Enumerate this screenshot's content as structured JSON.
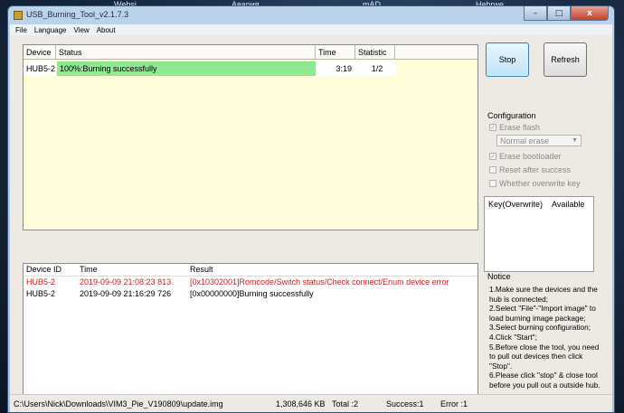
{
  "background_tabs": [
    "Websi",
    "Авария",
    "mAD",
    "Hebrwe"
  ],
  "window": {
    "title": "USB_Burning_Tool_v2.1.7.3",
    "controls": [
      "–",
      "□",
      "x"
    ]
  },
  "menu": [
    "File",
    "Language",
    "View",
    "About"
  ],
  "device_table": {
    "headers": [
      "Device ID",
      "Status",
      "Time",
      "Statistic"
    ],
    "rows": [
      {
        "device": "HUB5-2",
        "status": "100%:Burning successfully",
        "time": "3:19",
        "stat": "1/2",
        "status_color": "#90e890"
      }
    ]
  },
  "buttons": {
    "stop": "Stop",
    "refresh": "Refresh"
  },
  "configuration": {
    "title": "Configuration",
    "erase_flash": "Erase flash",
    "erase_mode": "Normal erase",
    "erase_bootloader": "Erase bootloader",
    "reset_after_success": "Reset after success",
    "overwrite_key": "Whether overwrite key"
  },
  "key_table": {
    "headers": [
      "Key(Overwrite)",
      "Available"
    ]
  },
  "log": {
    "headers": [
      "Device ID",
      "Time",
      "Result"
    ],
    "rows": [
      {
        "device": "HUB5-2",
        "time": "2019-09-09 21:08:23 813",
        "result": "[0x10302001]Romcode/Switch status/Check connect/Enum device error",
        "color": "#cc1f1f"
      },
      {
        "device": "HUB5-2",
        "time": "2019-09-09 21:16:29 726",
        "result": "[0x00000000]Burning successfully",
        "color": "#000000"
      }
    ]
  },
  "notice": {
    "title": "Notice",
    "lines": [
      "1.Make sure the devices and the hub is connected;",
      "2.Select \"File\"-\"Import image\" to load burning image package;",
      "3.Select burning configuration;",
      "4.Click \"Start\";",
      "5.Before close the tool, you need to pull out devices then click \"Stop\".",
      "6.Please click \"stop\" & close tool before you pull out a outside hub."
    ]
  },
  "status": {
    "path": "C:\\Users\\Nick\\Downloads\\VIM3_Pie_V190809\\update.img",
    "size": "1,308,646 KB",
    "total": "Total :2",
    "success": "Success:1",
    "error": "Error :1"
  }
}
